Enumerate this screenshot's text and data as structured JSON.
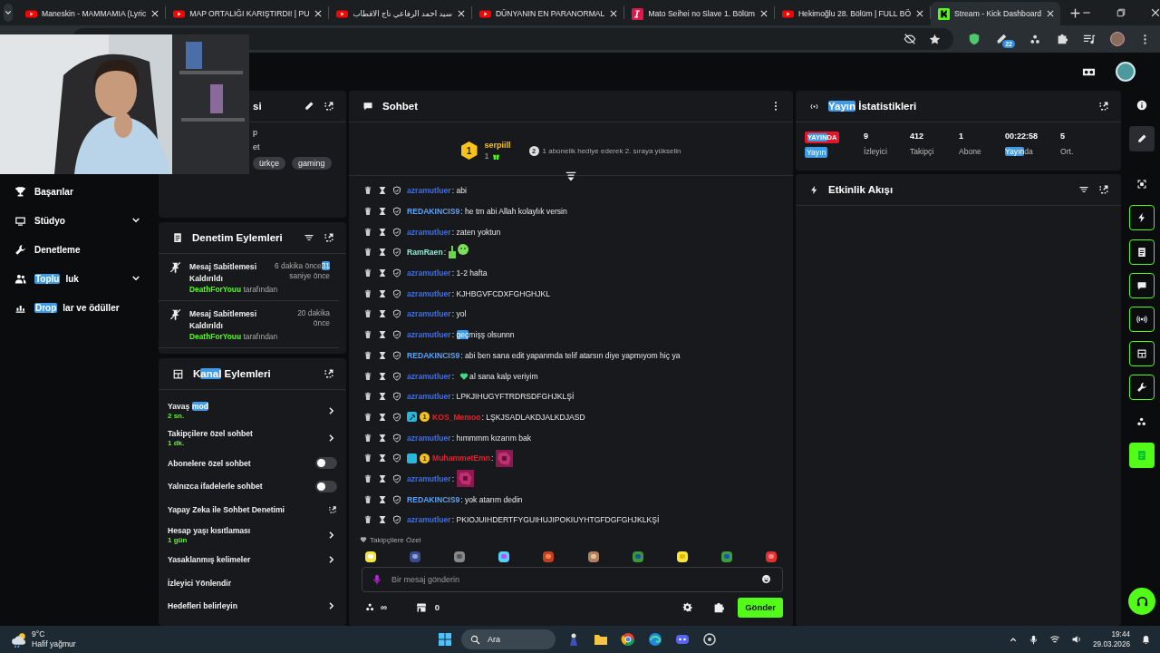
{
  "browser": {
    "tabs": [
      {
        "title": "Maneskin - MAMMAMIA (Lyric",
        "kind": "video",
        "selected": false
      },
      {
        "title": "MAP ORTALIĞI KARIŞTIRDI! | PU",
        "kind": "video",
        "selected": false
      },
      {
        "title": "سيد احمد الرفاعي تاج الاقطاب",
        "kind": "video",
        "selected": false
      },
      {
        "title": "DÜNYANIN EN PARANORMAL",
        "kind": "video",
        "selected": false
      },
      {
        "title": "Mato Seihei no Slave 1. Bölüm",
        "kind": "anime",
        "selected": false
      },
      {
        "title": "Hekimoğlu 28. Bölüm | FULL BÖ",
        "kind": "video",
        "selected": false
      },
      {
        "title": "Stream - Kick Dashboard",
        "kind": "dashboard",
        "selected": true
      }
    ],
    "extension_badge": "22"
  },
  "sidebar": {
    "items": [
      {
        "label": "Başarılar",
        "expandable": false
      },
      {
        "label": "Stüdyo",
        "expandable": true
      },
      {
        "label": "Denetleme",
        "expandable": false
      },
      {
        "label": [
          {
            "text": "Toplu",
            "highlighted": true
          },
          {
            "text": "luk",
            "highlighted": false
          }
        ],
        "expandable": true
      },
      {
        "label": [
          {
            "text": "Drop",
            "highlighted": true
          },
          {
            "text": "lar ve ödüller",
            "highlighted": false
          }
        ],
        "expandable": false
      }
    ]
  },
  "info_panel": {
    "title": "si",
    "lines": [
      "p",
      "et"
    ],
    "tags": [
      "ürkçe",
      "gaming"
    ]
  },
  "moderation_log": {
    "title": "Denetim Eylemleri",
    "entries": [
      {
        "action": "Mesaj Sabitlemesi Kaldırıldı",
        "by_user": "DeathForYouu",
        "by_text": "tarafından",
        "time_lines": [
          [
            {
              "text": "6 dakika önce",
              "highlighted": false
            },
            {
              "text": "31",
              "highlighted": true
            }
          ],
          "saniye önce"
        ]
      },
      {
        "action": "Mesaj Sabitlemesi Kaldırıldı",
        "by_user": "DeathForYouu",
        "by_text": "tarafından",
        "time_lines": [
          "20 dakika",
          "önce"
        ]
      }
    ]
  },
  "channel_actions": {
    "title": [
      {
        "text": "K",
        "highlighted": false
      },
      {
        "text": "anal",
        "highlighted": true
      },
      {
        "text": " Eylemleri",
        "highlighted": false
      }
    ],
    "rows": [
      {
        "kind": "submenu",
        "label": [
          {
            "text": "Yavaş ",
            "highlighted": false
          },
          {
            "text": "mod",
            "highlighted": true
          }
        ],
        "value": "2 sn."
      },
      {
        "kind": "submenu",
        "label": "Takipçilere özel sohbet",
        "value": "1 dk."
      },
      {
        "kind": "toggle",
        "label": "Abonelere özel sohbet",
        "on": false
      },
      {
        "kind": "toggle",
        "label": "Yalnızca ifadelerle sohbet",
        "on": false
      },
      {
        "kind": "external",
        "label": "Yapay Zeka ile Sohbet Denetimi"
      },
      {
        "kind": "submenu",
        "label": "Hesap yaşı kısıtlaması",
        "value": "1 gün"
      },
      {
        "kind": "submenu",
        "label": "Yasaklanmış kelimeler"
      },
      {
        "kind": "plain",
        "label": "İzleyici Yönlendir"
      },
      {
        "kind": "submenu",
        "label": "Hedefleri belirleyin"
      }
    ]
  },
  "chat": {
    "title": "Sohbet",
    "leaderboard": {
      "rank": "1",
      "user": "serpiill",
      "count": "1",
      "next_rank": "2",
      "prompt": "1 abonelik hediye ederek 2. sıraya yükselin"
    },
    "messages": [
      {
        "user": "azramutluer",
        "color": "#3f6fe6",
        "parts": [
          {
            "kind": "text",
            "text": ": abi"
          }
        ]
      },
      {
        "user": "REDAKINCIS9",
        "color": "#5aa2f5",
        "parts": [
          {
            "kind": "text",
            "text": ": he tm abi Allah kolaylık versin"
          }
        ]
      },
      {
        "user": "azramutluer",
        "color": "#3f6fe6",
        "parts": [
          {
            "kind": "text",
            "text": ": zaten yoktun"
          }
        ]
      },
      {
        "user": "RamRaen",
        "color": "#8ee6d6",
        "parts": [
          {
            "kind": "text",
            "text": ":"
          },
          {
            "kind": "thumbs-up"
          },
          {
            "kind": "smiley"
          }
        ]
      },
      {
        "user": "azramutluer",
        "color": "#3f6fe6",
        "parts": [
          {
            "kind": "text",
            "text": ": 1-2 hafta"
          }
        ]
      },
      {
        "user": "azramutluer",
        "color": "#3f6fe6",
        "parts": [
          {
            "kind": "text",
            "text": ": KJHBGVFCDXFGHGHJKL"
          }
        ]
      },
      {
        "user": "azramutluer",
        "color": "#3f6fe6",
        "parts": [
          {
            "kind": "text",
            "text": ": yol"
          }
        ]
      },
      {
        "user": "azramutluer",
        "color": "#3f6fe6",
        "parts": [
          {
            "kind": "text",
            "text": ": "
          },
          {
            "kind": "highlight",
            "text": "geç"
          },
          {
            "kind": "text",
            "text": "mişş olsunnn"
          }
        ]
      },
      {
        "user": "REDAKINCIS9",
        "color": "#5aa2f5",
        "parts": [
          {
            "kind": "text",
            "text": ": abi ben sana edit yapanmda telif atarsın diye yapmıyom hiç ya"
          }
        ]
      },
      {
        "user": "azramutluer",
        "color": "#3f6fe6",
        "parts": [
          {
            "kind": "text",
            "text": ":"
          },
          {
            "kind": "heart"
          },
          {
            "kind": "text",
            "text": "al sana kalp veriyim"
          }
        ]
      },
      {
        "user": "azramutluer",
        "color": "#3f6fe6",
        "parts": [
          {
            "kind": "text",
            "text": ": LPKJIHUGYFTRDRSDFGHJKLŞİ"
          }
        ]
      },
      {
        "user": "KOS_Memoo",
        "color": "#e5202c",
        "badges": [
          {
            "kind": "moderator"
          },
          {
            "kind": "subscriber",
            "text": "1"
          }
        ],
        "parts": [
          {
            "kind": "text",
            "text": ": LŞKJSADLAKDJALKDJASD"
          }
        ]
      },
      {
        "user": "azramutluer",
        "color": "#3f6fe6",
        "parts": [
          {
            "kind": "text",
            "text": ": hımmmm kızarım bak"
          }
        ]
      },
      {
        "user": "MuhammetEmn",
        "color": "#e5202c",
        "badges": [
          {
            "kind": "og"
          },
          {
            "kind": "subscriber",
            "text": "1"
          }
        ],
        "parts": [
          {
            "kind": "text",
            "text": ":"
          },
          {
            "kind": "sticker"
          }
        ]
      },
      {
        "user": "azramutluer",
        "color": "#3f6fe6",
        "parts": [
          {
            "kind": "text",
            "text": ":"
          },
          {
            "kind": "sticker"
          }
        ]
      },
      {
        "user": "REDAKINCIS9",
        "color": "#5aa2f5",
        "parts": [
          {
            "kind": "text",
            "text": ": yok atarım dedin"
          }
        ]
      },
      {
        "user": "azramutluer",
        "color": "#3f6fe6",
        "parts": [
          {
            "kind": "text",
            "text": ": PKIOJUIHDERTFYGUIHUJIPOKIUYHTGFDGFGHJKLKŞİ"
          }
        ]
      }
    ],
    "emote_section": "Takipçilere Özel",
    "input": {
      "placeholder": "Bir mesaj gönderin"
    },
    "points": "∞",
    "store_count": "0",
    "send": "Gönder"
  },
  "stream_stats": {
    "title": [
      {
        "text": "Yayın",
        "highlighted": true
      },
      {
        "text": " İstatistikleri",
        "highlighted": false
      }
    ],
    "live_badge": [
      {
        "text": "YAYIN",
        "highlighted": true
      },
      {
        "text": "DA",
        "highlighted": false
      }
    ],
    "live_label": [
      {
        "text": "Yayın",
        "highlighted": true
      }
    ],
    "items": [
      {
        "value": "9",
        "label": "İzleyici"
      },
      {
        "value": "412",
        "label": "Takipçi"
      },
      {
        "value": "1",
        "label": "Abone"
      },
      {
        "value": "00:22:58",
        "label": [
          {
            "text": "Yayın",
            "highlighted": true
          },
          {
            "text": "da",
            "highlighted": false
          }
        ]
      },
      {
        "value": "5",
        "label": "Ort."
      }
    ]
  },
  "event_feed": {
    "title": "Etkinlik Akışı"
  },
  "tool_rail": [
    {
      "kind": "plain",
      "selected": false
    },
    {
      "kind": "plain",
      "selected": true
    },
    {
      "kind": "plain",
      "selected": false
    },
    {
      "kind": "outlined",
      "selected": false
    },
    {
      "kind": "outlined",
      "selected": false
    },
    {
      "kind": "outlined",
      "selected": false
    },
    {
      "kind": "outlined",
      "selected": false
    },
    {
      "kind": "outlined",
      "selected": false
    },
    {
      "kind": "outlined",
      "selected": false
    },
    {
      "kind": "plain",
      "selected": false
    },
    {
      "kind": "filled",
      "selected": false
    }
  ],
  "taskbar": {
    "temperature": "9°C",
    "weather": "Hafif yağmur",
    "search": "Ara",
    "time": "19:44",
    "date": "29.03.2026"
  }
}
